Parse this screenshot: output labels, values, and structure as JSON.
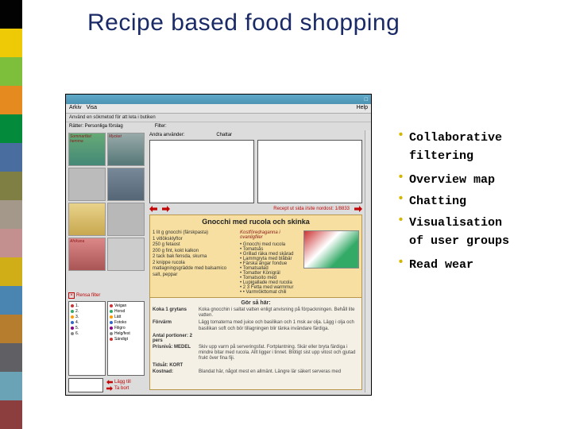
{
  "title": "Recipe based food shopping",
  "stripes": [
    "#020202",
    "#eec906",
    "#7dbf3a",
    "#e58a1f",
    "#038a3a",
    "#4a6da0",
    "#7f7f43",
    "#a3988a",
    "#c48f8f",
    "#cfae18",
    "#4a84b0",
    "#b67d2f",
    "#5f5f64",
    "#6aa3b5",
    "#8c3e3e"
  ],
  "app": {
    "menubar": {
      "arkiv": "Arkiv",
      "visa": "Visa",
      "help": "Help"
    },
    "hint": "Använd en sökmetod för att leta i butiken",
    "labels": {
      "ratter": "Rätter: Personliga förslag",
      "filter": "Filter:",
      "andra": "Andra använder:",
      "chattar": "Chattar"
    },
    "thumbs": [
      "Sommarfäst hemma",
      "Mycket",
      "",
      "",
      "",
      "",
      "Afrikana"
    ],
    "arrow_text": "Recept ut sida i/site nordost: 1/8833",
    "recipe": {
      "title": "Gnocchi med rucola och skinka",
      "ingredients": [
        "1 lit g gnocchi (färskpasta)",
        "1 vitlöksklyftor",
        "250 g fetaost",
        "200 g fint, kokt kalkon",
        "2 tack bak fensda, skurna",
        "2 knippe rucola",
        "matlagningsgrädde med balsamico",
        "salt, peppar"
      ],
      "suggest_label": "Kostföredraganna i ovanligfiler",
      "suggestions": [
        "Gnocchi med rucola",
        "Tomatsås",
        "Grillad räka med skärad",
        "Lammgryta med blåbär",
        "Färska ängar fondue",
        "Tomatsallad",
        "Tomatter Königräl",
        "Tomatsoito med",
        "Lupigallade med rucola",
        "2 3 Fetta med warmmur",
        "• Varmrökttomat chili"
      ],
      "steps": {
        "header": "Gör så här:",
        "rows": [
          {
            "k": "Koka 1 grytans",
            "v": "Koka gnocchin i saltat vatten enligt anvisning på förpackningen. Behåll lite vatten."
          },
          {
            "k": "Förvärm",
            "v": "Lägg tomaterna med juice och basilikan och 1 msk av olja. Lägg i olja och basilikan soft och bör tillagningen blir tänka invändare färdiga."
          },
          {
            "k": "Antal portioner: 2 pers",
            "v": ""
          },
          {
            "k": "Prisnivå: MEDEL",
            "v": "Skiv upp varm på serveringsfat. Fortplantning. Skär eller bryta färdiga i mindre bitar med rucola. Allt ligger i tinnet. Blötigt sist upp vitost och gjutad frukt över fina fiji."
          },
          {
            "k": "Tidsåt: KORT",
            "v": ""
          },
          {
            "k": "Kostnad:",
            "v": "Blandat här, något mest en allmänt. Längre lär säkert serveras med"
          }
        ]
      }
    },
    "rensa": "Rensa filter",
    "lists": {
      "a": [
        "1.",
        "2.",
        "3.",
        "4.",
        "5.",
        "6."
      ],
      "b": [
        "Veigan",
        "Horsd",
        "Lätt",
        "Fotoko",
        "Filigro",
        "Helg/fest",
        "Sändigt"
      ]
    },
    "footer": {
      "lagg": "Lägg till",
      "tabort": "Ta bort"
    }
  },
  "bullets": [
    {
      "line": "Collaborative",
      "cont": "filtering"
    },
    {
      "line": "Overview map"
    },
    {
      "line": "Chatting"
    },
    {
      "line": "Visualisation",
      "cont": "of user groups"
    },
    {
      "line": "Read wear"
    }
  ]
}
